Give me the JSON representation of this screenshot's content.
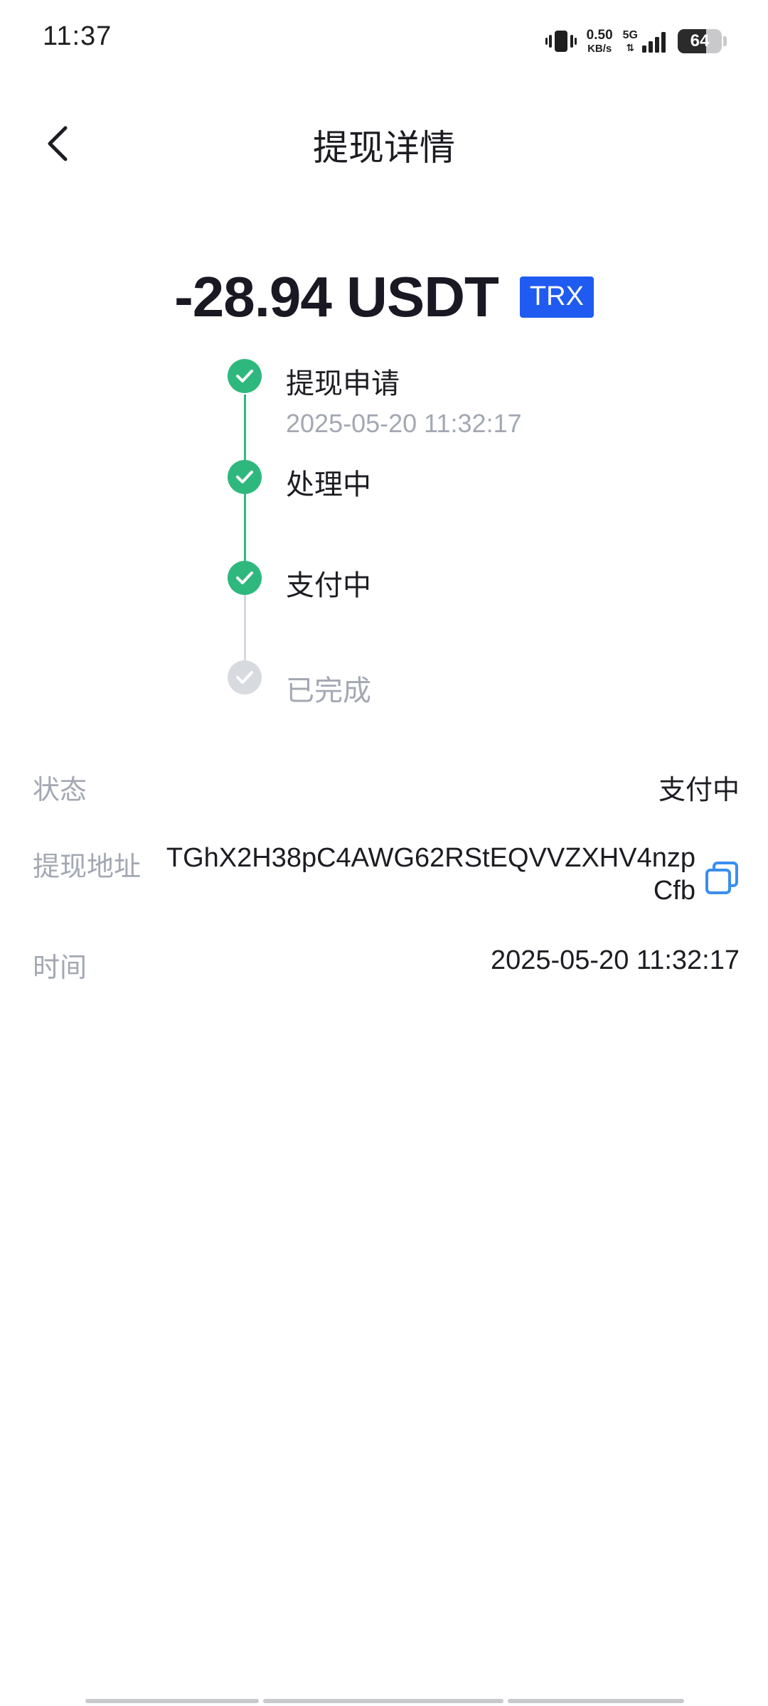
{
  "status_bar": {
    "time": "11:37",
    "net_speed_value": "0.50",
    "net_speed_unit": "KB/s",
    "network_type": "5G",
    "battery_level": "64",
    "battery_fraction": 0.64,
    "icons": [
      "vibrate-icon",
      "data-arrows-icon",
      "signal-icon",
      "battery-icon"
    ]
  },
  "header": {
    "title": "提现详情",
    "back_icon": "chevron-left-icon"
  },
  "withdrawal": {
    "amount": "-28.94 USDT",
    "chain": "TRX"
  },
  "timeline": {
    "steps": [
      {
        "label": "提现申请",
        "time": "2025-05-20 11:32:17",
        "done": true
      },
      {
        "label": "处理中",
        "done": true
      },
      {
        "label": "支付中",
        "done": true
      },
      {
        "label": "已完成",
        "done": false
      }
    ],
    "colors": {
      "done": "#2fb87d",
      "todo": "#d7dade"
    }
  },
  "details": {
    "status_label": "状态",
    "status_value": "支付中",
    "address_label": "提现地址",
    "address_value": "TGhX2H38pC4AWG62RStEQVVZXHV4nzpCfb",
    "copy_icon": "copy-icon",
    "time_label": "时间",
    "time_value": "2025-05-20 11:32:17"
  },
  "colors": {
    "accent_blue": "#1f5bf0",
    "success_green": "#2fb87d",
    "muted_text": "#a3a8b3"
  }
}
